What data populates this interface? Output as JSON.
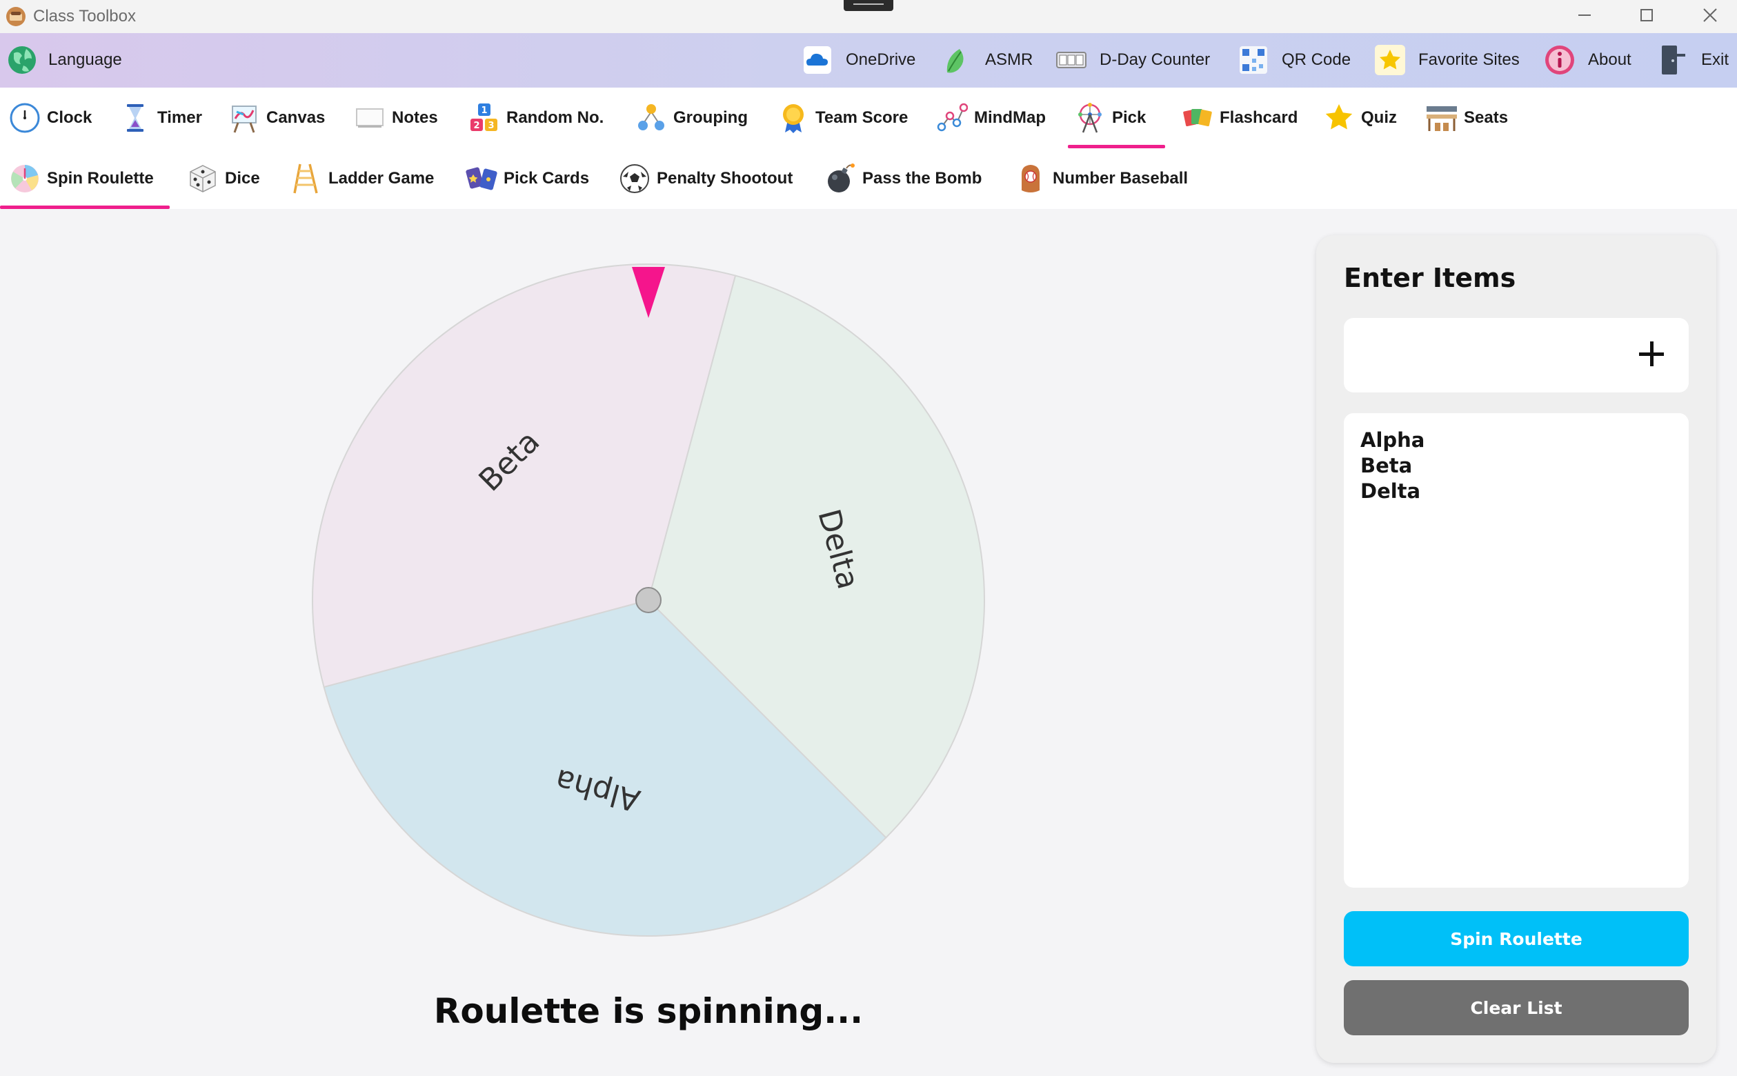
{
  "window": {
    "title": "Class Toolbox"
  },
  "topbar": {
    "language_label": "Language",
    "items": [
      {
        "label": "OneDrive",
        "icon": "cloud-icon"
      },
      {
        "label": "ASMR",
        "icon": "leaf-icon"
      },
      {
        "label": "D-Day Counter",
        "icon": "counter-icon"
      },
      {
        "label": "QR Code",
        "icon": "qr-code-icon"
      },
      {
        "label": "Favorite Sites",
        "icon": "star-icon"
      },
      {
        "label": "About",
        "icon": "info-icon"
      },
      {
        "label": "Exit",
        "icon": "exit-door-icon"
      }
    ]
  },
  "tabs_row1": [
    {
      "label": "Clock",
      "icon": "clock-icon"
    },
    {
      "label": "Timer",
      "icon": "hourglass-icon"
    },
    {
      "label": "Canvas",
      "icon": "easel-icon"
    },
    {
      "label": "Notes",
      "icon": "whiteboard-icon"
    },
    {
      "label": "Random No.",
      "icon": "number-blocks-icon"
    },
    {
      "label": "Grouping",
      "icon": "group-icon"
    },
    {
      "label": "Team Score",
      "icon": "medal-icon"
    },
    {
      "label": "MindMap",
      "icon": "mindmap-icon"
    },
    {
      "label": "Pick",
      "icon": "ferris-wheel-icon",
      "active": true
    },
    {
      "label": "Flashcard",
      "icon": "cards-icon"
    },
    {
      "label": "Quiz",
      "icon": "star-icon"
    },
    {
      "label": "Seats",
      "icon": "desks-icon"
    }
  ],
  "tabs_row2": [
    {
      "label": "Spin Roulette",
      "icon": "roulette-icon",
      "active": true
    },
    {
      "label": "Dice",
      "icon": "dice-icon"
    },
    {
      "label": "Ladder Game",
      "icon": "ladder-icon"
    },
    {
      "label": "Pick Cards",
      "icon": "playing-cards-icon"
    },
    {
      "label": "Penalty Shootout",
      "icon": "soccer-ball-icon"
    },
    {
      "label": "Pass the Bomb",
      "icon": "bomb-icon"
    },
    {
      "label": "Number Baseball",
      "icon": "baseball-glove-icon"
    }
  ],
  "wheel": {
    "segments": [
      {
        "label": "Alpha",
        "color": "#d2e6ee"
      },
      {
        "label": "Beta",
        "color": "#f0e7ef"
      },
      {
        "label": "Delta",
        "color": "#e6efea"
      }
    ],
    "pointer_color": "#f5158c"
  },
  "status_text": "Roulette is spinning...",
  "panel": {
    "title": "Enter Items",
    "input_placeholder": "",
    "items": [
      "Alpha",
      "Beta",
      "Delta"
    ],
    "spin_button": "Spin Roulette",
    "clear_button": "Clear List"
  },
  "colors": {
    "accent": "#ef1f8c",
    "spin_button": "#00c0f8",
    "clear_button": "#707070"
  }
}
